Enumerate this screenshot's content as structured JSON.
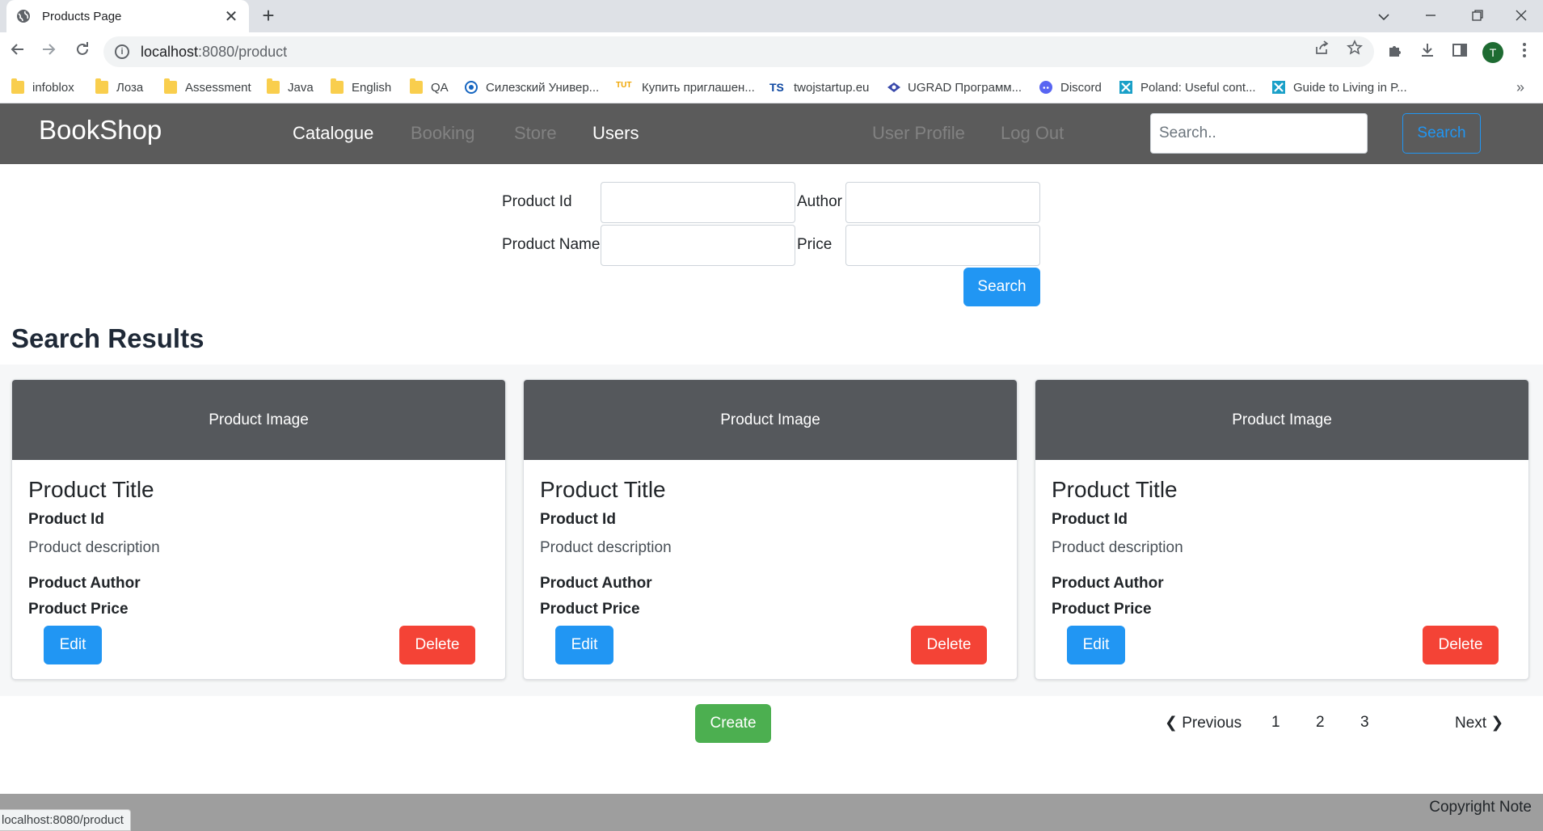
{
  "browser": {
    "tab_title": "Products Page",
    "tab_close": "✕",
    "new_tab": "+",
    "url_host": "localhost",
    "url_rest": ":8080/product",
    "profile_initial": "T",
    "status_url": "localhost:8080/product",
    "icons": {
      "back": "back-arrow-icon",
      "forward": "forward-arrow-icon",
      "reload": "reload-icon",
      "info": "site-info-icon",
      "share": "share-icon",
      "star": "bookmark-star-icon",
      "extensions": "puzzle-icon",
      "download": "download-icon",
      "sidepanel": "side-panel-icon",
      "menu": "kebab-menu-icon"
    }
  },
  "bookmarks": [
    {
      "label": "infoblox",
      "icon": "folder-icon"
    },
    {
      "label": "Лоза",
      "icon": "folder-icon"
    },
    {
      "label": "Assessment",
      "icon": "folder-icon"
    },
    {
      "label": "Java",
      "icon": "folder-icon"
    },
    {
      "label": "English",
      "icon": "folder-icon"
    },
    {
      "label": "QA",
      "icon": "folder-icon"
    },
    {
      "label": "Силезский Универ...",
      "icon": "university-icon"
    },
    {
      "label": "Купить приглашен...",
      "icon": "tut-icon"
    },
    {
      "label": "twojstartup.eu",
      "icon": "ts-icon"
    },
    {
      "label": "UGRAD Программ...",
      "icon": "ugrad-icon"
    },
    {
      "label": "Discord",
      "icon": "discord-icon"
    },
    {
      "label": "Poland: Useful cont...",
      "icon": "x-site-icon"
    },
    {
      "label": "Guide to Living in P...",
      "icon": "x-site-icon"
    }
  ],
  "bookmarks_more": "»",
  "navbar": {
    "brand": "BookShop",
    "links": [
      {
        "label": "Catalogue",
        "state": "active"
      },
      {
        "label": "Booking",
        "state": "muted"
      },
      {
        "label": "Store",
        "state": "muted"
      },
      {
        "label": "Users",
        "state": "active"
      },
      {
        "label": "User Profile",
        "state": "muted"
      },
      {
        "label": "Log Out",
        "state": "muted"
      }
    ],
    "search_placeholder": "Search..",
    "search_button": "Search"
  },
  "search_form": {
    "product_id_label": "Product Id",
    "author_label": "Author",
    "product_name_label": "Product Name",
    "price_label": "Price",
    "product_id_value": "",
    "author_value": "",
    "product_name_value": "",
    "price_value": "",
    "submit_label": "Search"
  },
  "results": {
    "heading": "Search Results",
    "cards": [
      {
        "image": "Product Image",
        "title": "Product Title",
        "id": "Product Id",
        "description": "Product description",
        "author": "Product Author",
        "price": "Product Price",
        "edit": "Edit",
        "delete": "Delete"
      },
      {
        "image": "Product Image",
        "title": "Product Title",
        "id": "Product Id",
        "description": "Product description",
        "author": "Product Author",
        "price": "Product Price",
        "edit": "Edit",
        "delete": "Delete"
      },
      {
        "image": "Product Image",
        "title": "Product Title",
        "id": "Product Id",
        "description": "Product description",
        "author": "Product Author",
        "price": "Product Price",
        "edit": "Edit",
        "delete": "Delete"
      }
    ]
  },
  "actions": {
    "create": "Create"
  },
  "pagination": {
    "previous": "❮ Previous",
    "pages": [
      "1",
      "2",
      "3"
    ],
    "next": "Next ❯"
  },
  "footer": {
    "copyright": "Copyright Note"
  },
  "colors": {
    "navbar_bg": "#5b5b5b",
    "primary": "#2196f3",
    "danger": "#f44336",
    "success": "#4caf50",
    "card_image_bg": "#55585c",
    "footer_bg": "#9e9e9e"
  }
}
